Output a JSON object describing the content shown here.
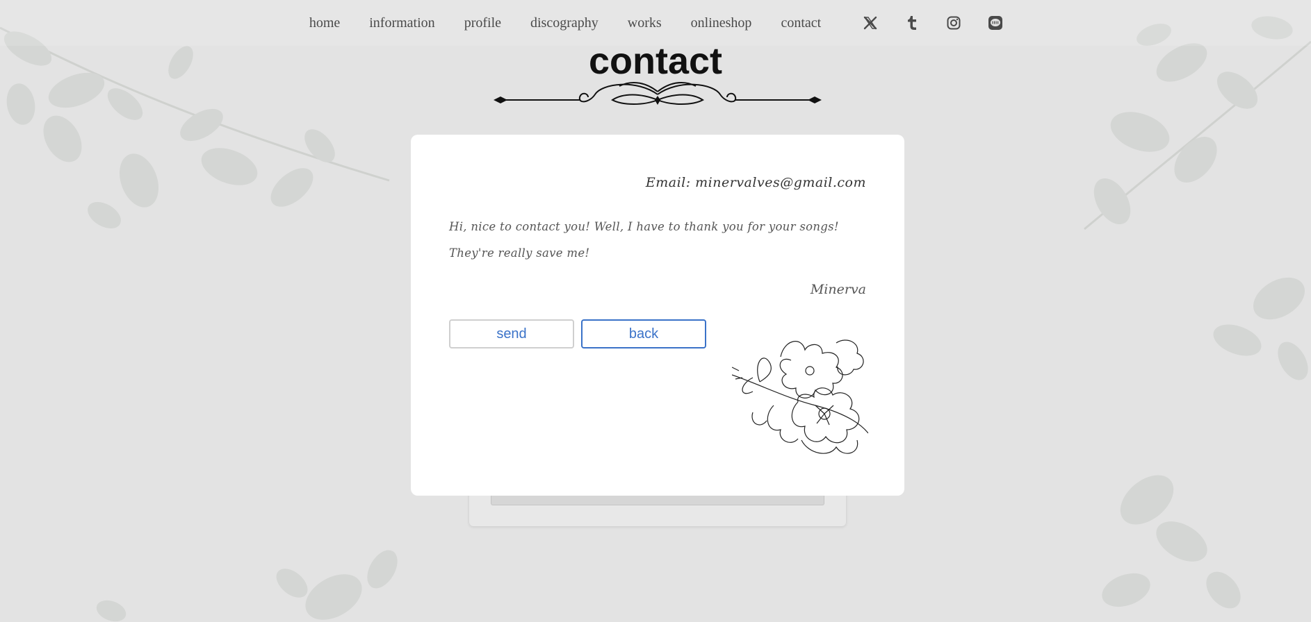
{
  "nav": {
    "items": [
      {
        "label": "home"
      },
      {
        "label": "information"
      },
      {
        "label": "profile"
      },
      {
        "label": "discography"
      },
      {
        "label": "works"
      },
      {
        "label": "onlineshop"
      },
      {
        "label": "contact"
      }
    ],
    "icons": [
      "x-twitter-icon",
      "tumblr-icon",
      "instagram-icon",
      "line-icon"
    ]
  },
  "page": {
    "title": "contact"
  },
  "letter": {
    "email": "Email: minervalves@gmail.com",
    "message_line1": "Hi, nice to contact you! Well, I have to thank you for your songs!",
    "message_line2": "They're really save me!",
    "signature": "Minerva"
  },
  "buttons": {
    "send_label": "send",
    "back_label": "back"
  },
  "colors": {
    "background": "#e3e3e3",
    "accent": "#3a72c8",
    "card": "#ffffff"
  }
}
